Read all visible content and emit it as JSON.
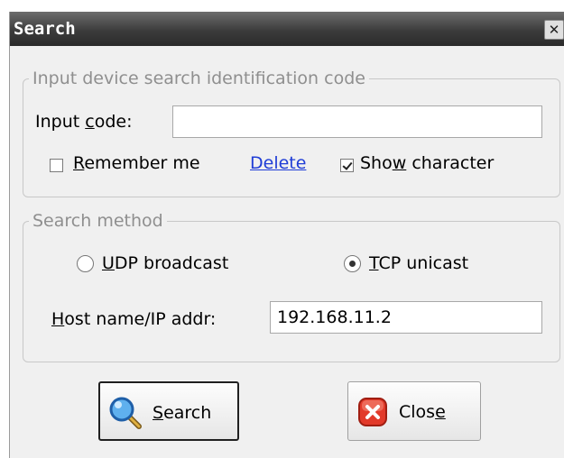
{
  "dialog": {
    "title": "Search"
  },
  "code_group": {
    "legend": "Input device search identification code",
    "input_label_pre": "Input ",
    "input_label_mn": "c",
    "input_label_post": "ode:",
    "input_value": "",
    "remember": {
      "mn": "R",
      "rest": "emember me",
      "checked": false
    },
    "delete_link": "Delete",
    "show_char": {
      "pre": "Sho",
      "mn": "w",
      "post": " character",
      "checked": true
    }
  },
  "method_group": {
    "legend": "Search method",
    "udp": {
      "mn": "U",
      "rest": "DP broadcast",
      "selected": false
    },
    "tcp": {
      "mn": "T",
      "rest": "CP unicast",
      "selected": true
    },
    "host_label_mn": "H",
    "host_label_rest": "ost name/IP addr:",
    "host_value": "192.168.11.2"
  },
  "buttons": {
    "search": {
      "mn": "S",
      "rest": "earch"
    },
    "close": {
      "pre": "Clos",
      "mn": "e"
    }
  }
}
